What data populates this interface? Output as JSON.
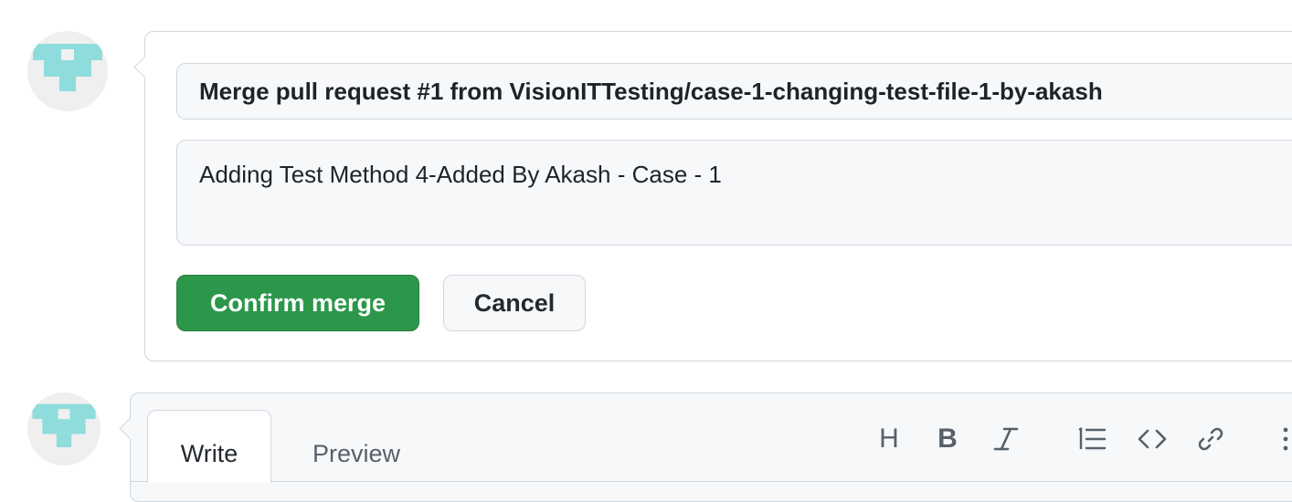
{
  "merge": {
    "commit_title": "Merge pull request #1 from VisionITTesting/case-1-changing-test-file-1-by-akash",
    "commit_message": "Adding Test Method 4-Added By Akash - Case - 1",
    "confirm_label": "Confirm merge",
    "cancel_label": "Cancel"
  },
  "comment": {
    "tabs": [
      {
        "label": "Write",
        "selected": true
      },
      {
        "label": "Preview",
        "selected": false
      }
    ],
    "toolbar": [
      {
        "icon": "heading-icon",
        "glyph": "H"
      },
      {
        "icon": "bold-icon",
        "glyph": "B"
      },
      {
        "icon": "italic-icon",
        "glyph": "I"
      },
      {
        "icon": "ordered-list-icon"
      },
      {
        "icon": "code-icon"
      },
      {
        "icon": "link-icon"
      },
      {
        "icon": "more-icon"
      }
    ]
  },
  "colors": {
    "avatar_identicon": "#8fdcdc",
    "confirm_button": "#2c974b",
    "border": "#d0d7de"
  }
}
